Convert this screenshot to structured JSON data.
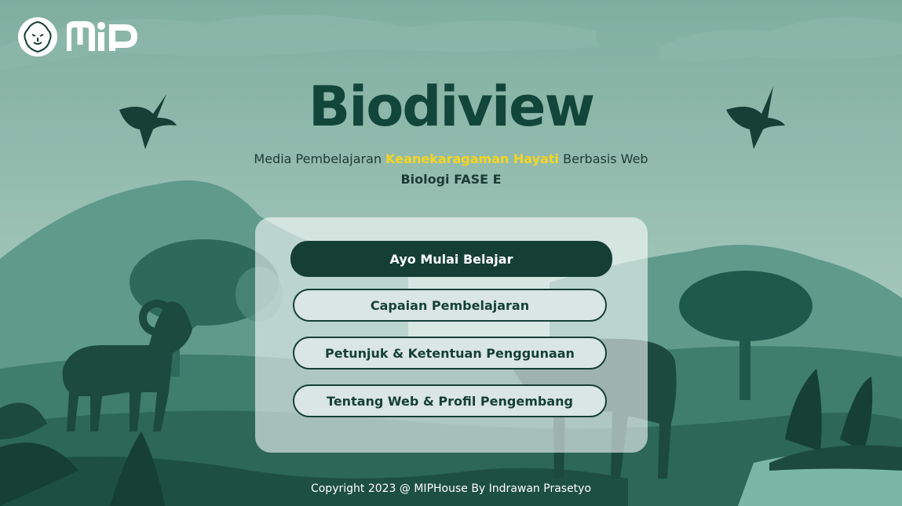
{
  "header": {
    "lion_logo_icon": "lion-head-icon",
    "mip_logo_text": "MIP"
  },
  "brand": {
    "title": "Biodiview"
  },
  "subtitle": {
    "part1": "Media Pembelajaran ",
    "highlight": "Keanekaragaman Hayati",
    "part2": " Berbasis Web",
    "line2": "Biologi FASE E"
  },
  "menu": {
    "start_label": "Ayo Mulai Belajar",
    "capaian_label": "Capaian Pembelajaran",
    "petunjuk_label": "Petunjuk & Ketentuan Penggunaan",
    "tentang_label": "Tentang Web & Profil Pengembang"
  },
  "footer": {
    "copyright": "Copyright 2023 @ MIPHouse By Indrawan Prasetyo"
  },
  "colors": {
    "dark_green": "#153f35",
    "highlight_yellow": "#f5d51f",
    "sky": "#9ac2b4"
  }
}
